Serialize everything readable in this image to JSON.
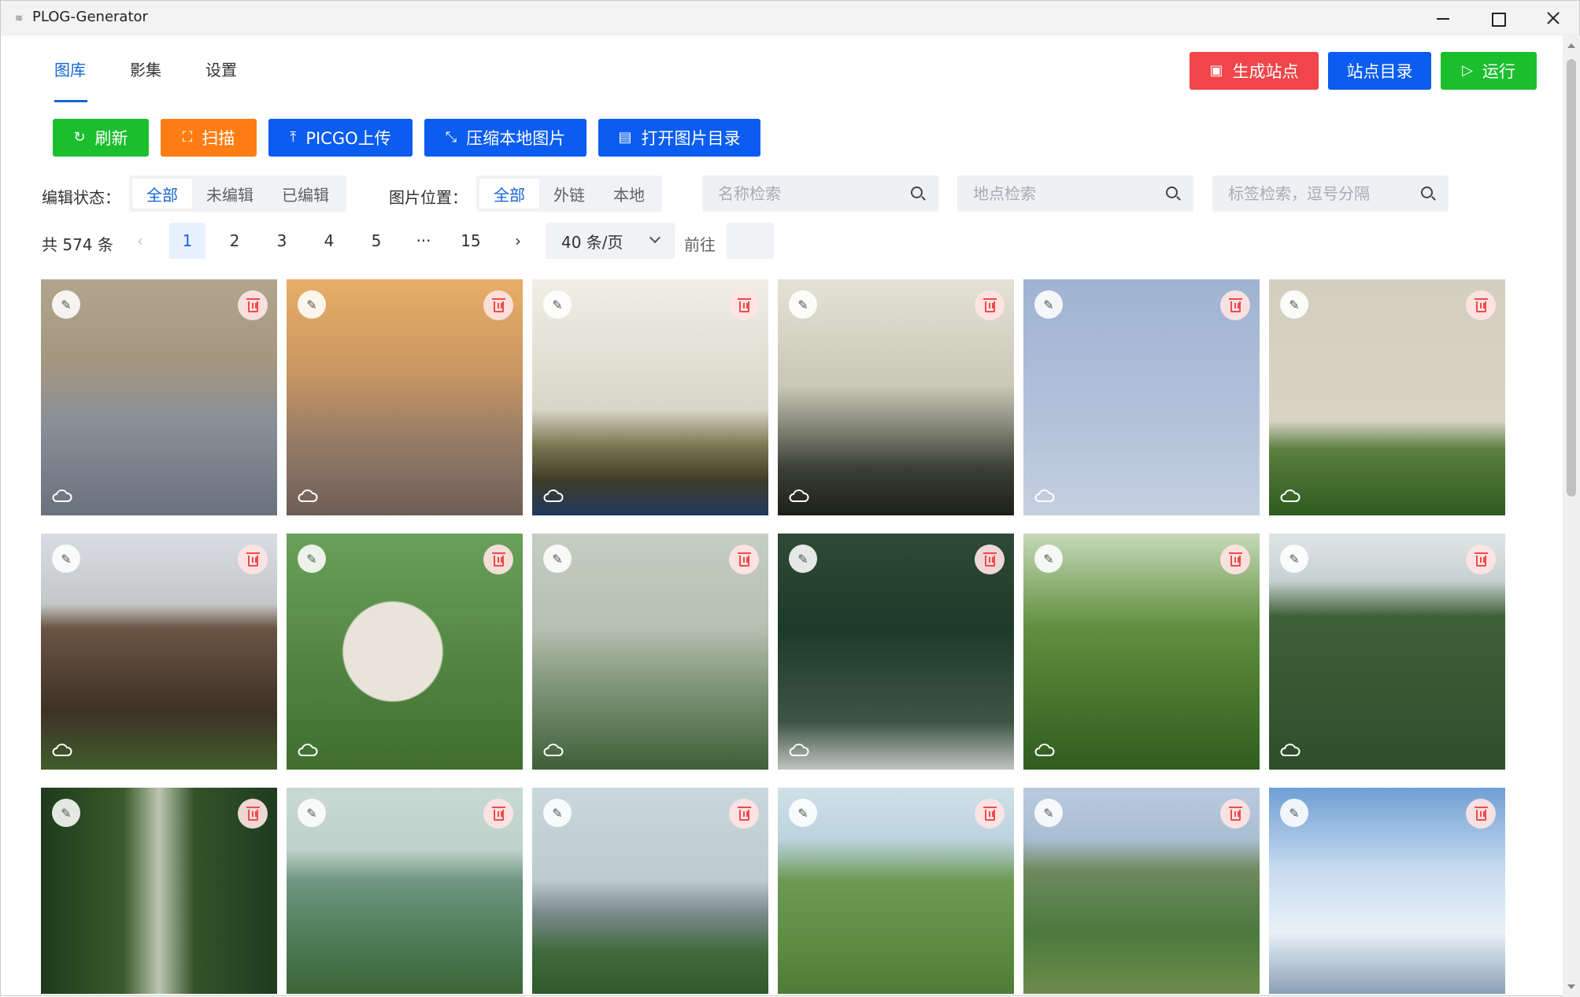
{
  "window": {
    "title": "PLOG-Generator"
  },
  "tabs": [
    {
      "label": "图库",
      "active": true
    },
    {
      "label": "影集",
      "active": false
    },
    {
      "label": "设置",
      "active": false
    }
  ],
  "header_buttons": {
    "generate_site": "生成站点",
    "site_dir": "站点目录",
    "run": "运行"
  },
  "toolbar": {
    "refresh": "刷新",
    "scan": "扫描",
    "picgo_upload": "PICGO上传",
    "compress": "压缩本地图片",
    "open_dir": "打开图片目录"
  },
  "filters": {
    "edit_status_label": "编辑状态：",
    "edit_status_options": [
      "全部",
      "未编辑",
      "已编辑"
    ],
    "edit_status_selected": "全部",
    "location_label": "图片位置：",
    "location_options": [
      "全部",
      "外链",
      "本地"
    ],
    "location_selected": "全部",
    "name_search_placeholder": "名称检索",
    "place_search_placeholder": "地点检索",
    "tag_search_placeholder": "标签检索，逗号分隔"
  },
  "pagination": {
    "total_text": "共 574 条",
    "pages": [
      "1",
      "2",
      "3",
      "4",
      "5",
      "···",
      "15"
    ],
    "current_page": "1",
    "page_size": "40 条/页",
    "jump_label": "前往",
    "jump_value": ""
  },
  "colors": {
    "primary": "#0b5cf0",
    "danger": "#f0464a",
    "success": "#1bbf2e",
    "warning": "#ff7d14",
    "active_text": "#1565d8"
  },
  "photos": [
    {
      "scene": "hazy-sunrise",
      "stored": "cloud"
    },
    {
      "scene": "orange-sunset",
      "stored": "cloud"
    },
    {
      "scene": "wind-turbines-haze",
      "stored": "cloud"
    },
    {
      "scene": "misty-hills",
      "stored": "cloud"
    },
    {
      "scene": "birds-blue-sky",
      "stored": "cloud"
    },
    {
      "scene": "grassland-bird",
      "stored": "cloud"
    },
    {
      "scene": "plowed-field",
      "stored": "cloud"
    },
    {
      "scene": "sheep",
      "stored": "cloud"
    },
    {
      "scene": "foggy-valley",
      "stored": "cloud"
    },
    {
      "scene": "dark-forest",
      "stored": "cloud"
    },
    {
      "scene": "wildflowers",
      "stored": "cloud"
    },
    {
      "scene": "turbine-forest",
      "stored": "cloud"
    },
    {
      "scene": "tree-lined-road",
      "stored": "cloud"
    },
    {
      "scene": "green-hills",
      "stored": "cloud"
    },
    {
      "scene": "turbines-hills",
      "stored": "cloud"
    },
    {
      "scene": "road-to-turbine",
      "stored": "cloud"
    },
    {
      "scene": "valley-road",
      "stored": "cloud"
    },
    {
      "scene": "cloudy-sky",
      "stored": "cloud"
    }
  ]
}
